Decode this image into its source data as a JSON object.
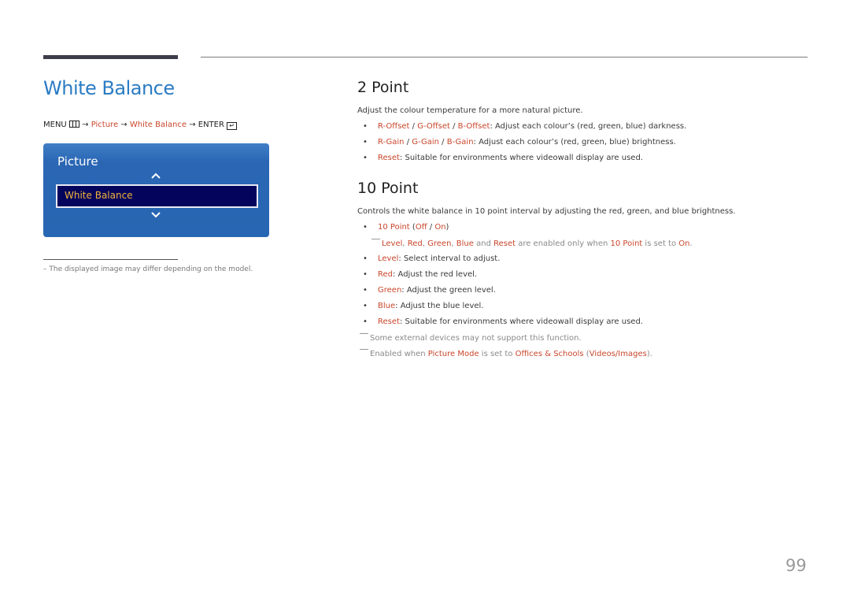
{
  "title": "White Balance",
  "breadcrumb": {
    "menu": "MENU",
    "arrow": "→",
    "picture": "Picture",
    "white_balance": "White Balance",
    "enter": "ENTER",
    "enter_glyph": "↵"
  },
  "osd": {
    "title": "Picture",
    "selected_item": "White Balance"
  },
  "footnote": "–  The displayed image may differ depending on the model.",
  "two_point": {
    "heading": "2 Point",
    "intro": "Adjust the colour temperature for a more natural picture.",
    "items": [
      {
        "terms": [
          "R-Offset",
          "G-Offset",
          "B-Offset"
        ],
        "sep": " / ",
        "desc": ": Adjust each colour’s (red, green, blue) darkness."
      },
      {
        "terms": [
          "R-Gain",
          "G-Gain",
          "B-Gain"
        ],
        "sep": " / ",
        "desc": ": Adjust each colour’s (red, green, blue) brightness."
      },
      {
        "terms": [
          "Reset"
        ],
        "sep": "",
        "desc": ": Suitable for environments where videowall display are used."
      }
    ]
  },
  "ten_point": {
    "heading": "10 Point",
    "intro": "Controls the white balance in 10 point interval by adjusting the red, green, and blue brightness.",
    "toggle": {
      "label": "10 Point",
      "off": "Off",
      "on": "On"
    },
    "toggle_note": {
      "level": "Level",
      "red": "Red",
      "green": "Green",
      "blue": "Blue",
      "and": " and ",
      "reset": "Reset",
      "mid": " are enabled only when ",
      "ten_point": "10 Point",
      "set_to": " is set to ",
      "on": "On",
      "end": "."
    },
    "items": [
      {
        "term": "Level",
        "desc": ": Select interval to adjust."
      },
      {
        "term": "Red",
        "desc": ": Adjust the red level."
      },
      {
        "term": "Green",
        "desc": ": Adjust the green level."
      },
      {
        "term": "Blue",
        "desc": ": Adjust the blue level."
      },
      {
        "term": "Reset",
        "desc": ": Suitable for environments where videowall display are used."
      }
    ],
    "note_external": "Some external devices may not support this function.",
    "note_enabled": {
      "prefix": "Enabled when ",
      "picture_mode": "Picture Mode",
      "mid": " is set to ",
      "offices": "Offices & Schools",
      "paren_open": " (",
      "videos": "Videos/Images",
      "paren_close": ")."
    }
  },
  "page_number": "99",
  "colors": {
    "title_blue": "#2b7cc4",
    "highlight": "#c9462b",
    "osd_blue": "#2766b2",
    "osd_selected": "#04045c",
    "osd_selected_text": "#f0b43c"
  }
}
